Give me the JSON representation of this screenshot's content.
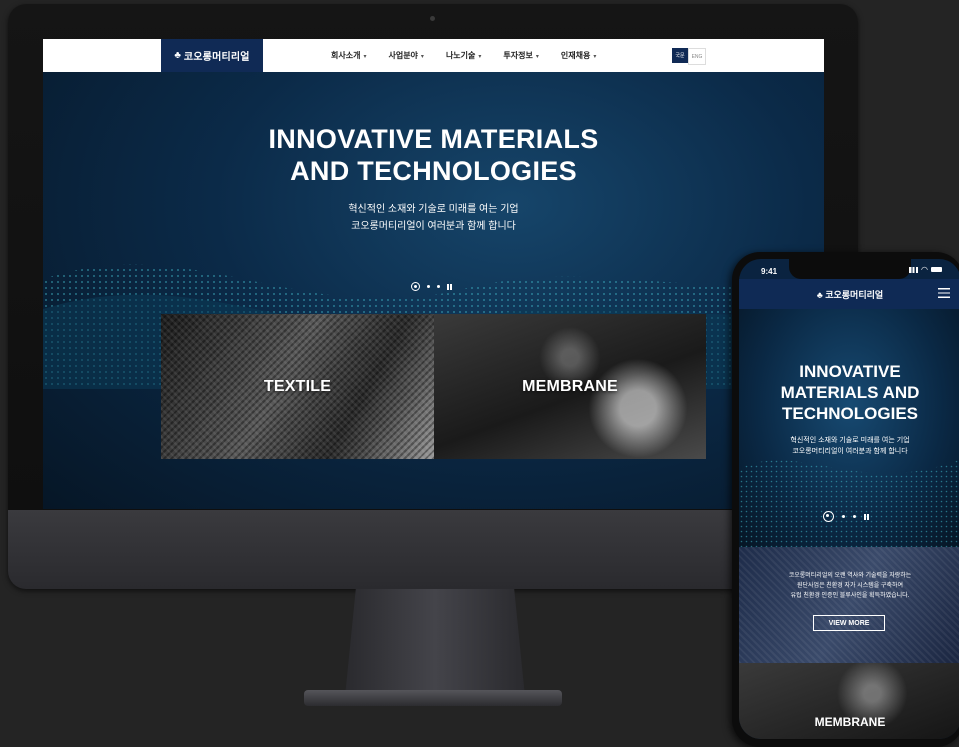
{
  "desktop": {
    "logo": {
      "mark": "♣",
      "text": "코오롱머티리얼"
    },
    "menu": [
      {
        "label": "회사소개"
      },
      {
        "label": "사업분야"
      },
      {
        "label": "나노기술"
      },
      {
        "label": "투자정보"
      },
      {
        "label": "인재채용"
      }
    ],
    "caret": "▾",
    "lang": {
      "kor": "국문",
      "eng": "ENG"
    },
    "hero": {
      "title_line1": "INNOVATIVE MATERIALS",
      "title_line2": "AND TECHNOLOGIES",
      "sub_line1": "혁신적인 소재와 기술로 미래를 여는 기업",
      "sub_line2": "코오롱머티리얼이 여러분과 함께 합니다"
    },
    "cards": {
      "textile": "TEXTILE",
      "membrane": "MEMBRANE"
    },
    "slider": {
      "slides": 3,
      "active": 1
    }
  },
  "mobile": {
    "time": "9:41",
    "logo": "♣ 코오롱머티리얼",
    "hero": {
      "title_line1": "INNOVATIVE",
      "title_line2": "MATERIALS AND",
      "title_line3": "TECHNOLOGIES",
      "sub_line1": "혁신적인 소재와 기술로 미래를 여는 기업",
      "sub_line2": "코오롱머티리얼이 여러분과 함께 합니다"
    },
    "info": {
      "line1": "코오롱머티리얼의 오랜 역사와 기술력을 자랑하는",
      "line2": "원단사업은 친환경 자가 시스템을 구축하여",
      "line3": "유럽 친환경 인증인 블루사인을 획득하였습니다.",
      "view_more": "VIEW MORE"
    },
    "membrane_label": "MEMBRANE"
  },
  "colors": {
    "brand": "#102a55",
    "background": "#242424"
  }
}
